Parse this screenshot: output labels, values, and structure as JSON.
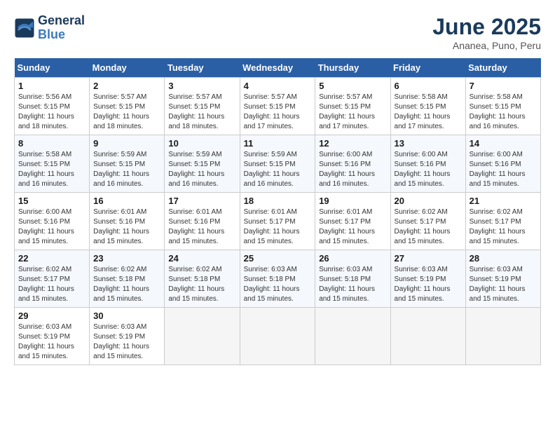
{
  "logo": {
    "line1": "General",
    "line2": "Blue"
  },
  "title": "June 2025",
  "subtitle": "Ananea, Puno, Peru",
  "days_of_week": [
    "Sunday",
    "Monday",
    "Tuesday",
    "Wednesday",
    "Thursday",
    "Friday",
    "Saturday"
  ],
  "weeks": [
    [
      {
        "day": "1",
        "sunrise": "Sunrise: 5:56 AM",
        "sunset": "Sunset: 5:15 PM",
        "daylight": "Daylight: 11 hours and 18 minutes."
      },
      {
        "day": "2",
        "sunrise": "Sunrise: 5:57 AM",
        "sunset": "Sunset: 5:15 PM",
        "daylight": "Daylight: 11 hours and 18 minutes."
      },
      {
        "day": "3",
        "sunrise": "Sunrise: 5:57 AM",
        "sunset": "Sunset: 5:15 PM",
        "daylight": "Daylight: 11 hours and 18 minutes."
      },
      {
        "day": "4",
        "sunrise": "Sunrise: 5:57 AM",
        "sunset": "Sunset: 5:15 PM",
        "daylight": "Daylight: 11 hours and 17 minutes."
      },
      {
        "day": "5",
        "sunrise": "Sunrise: 5:57 AM",
        "sunset": "Sunset: 5:15 PM",
        "daylight": "Daylight: 11 hours and 17 minutes."
      },
      {
        "day": "6",
        "sunrise": "Sunrise: 5:58 AM",
        "sunset": "Sunset: 5:15 PM",
        "daylight": "Daylight: 11 hours and 17 minutes."
      },
      {
        "day": "7",
        "sunrise": "Sunrise: 5:58 AM",
        "sunset": "Sunset: 5:15 PM",
        "daylight": "Daylight: 11 hours and 16 minutes."
      }
    ],
    [
      {
        "day": "8",
        "sunrise": "Sunrise: 5:58 AM",
        "sunset": "Sunset: 5:15 PM",
        "daylight": "Daylight: 11 hours and 16 minutes."
      },
      {
        "day": "9",
        "sunrise": "Sunrise: 5:59 AM",
        "sunset": "Sunset: 5:15 PM",
        "daylight": "Daylight: 11 hours and 16 minutes."
      },
      {
        "day": "10",
        "sunrise": "Sunrise: 5:59 AM",
        "sunset": "Sunset: 5:15 PM",
        "daylight": "Daylight: 11 hours and 16 minutes."
      },
      {
        "day": "11",
        "sunrise": "Sunrise: 5:59 AM",
        "sunset": "Sunset: 5:15 PM",
        "daylight": "Daylight: 11 hours and 16 minutes."
      },
      {
        "day": "12",
        "sunrise": "Sunrise: 6:00 AM",
        "sunset": "Sunset: 5:16 PM",
        "daylight": "Daylight: 11 hours and 16 minutes."
      },
      {
        "day": "13",
        "sunrise": "Sunrise: 6:00 AM",
        "sunset": "Sunset: 5:16 PM",
        "daylight": "Daylight: 11 hours and 15 minutes."
      },
      {
        "day": "14",
        "sunrise": "Sunrise: 6:00 AM",
        "sunset": "Sunset: 5:16 PM",
        "daylight": "Daylight: 11 hours and 15 minutes."
      }
    ],
    [
      {
        "day": "15",
        "sunrise": "Sunrise: 6:00 AM",
        "sunset": "Sunset: 5:16 PM",
        "daylight": "Daylight: 11 hours and 15 minutes."
      },
      {
        "day": "16",
        "sunrise": "Sunrise: 6:01 AM",
        "sunset": "Sunset: 5:16 PM",
        "daylight": "Daylight: 11 hours and 15 minutes."
      },
      {
        "day": "17",
        "sunrise": "Sunrise: 6:01 AM",
        "sunset": "Sunset: 5:16 PM",
        "daylight": "Daylight: 11 hours and 15 minutes."
      },
      {
        "day": "18",
        "sunrise": "Sunrise: 6:01 AM",
        "sunset": "Sunset: 5:17 PM",
        "daylight": "Daylight: 11 hours and 15 minutes."
      },
      {
        "day": "19",
        "sunrise": "Sunrise: 6:01 AM",
        "sunset": "Sunset: 5:17 PM",
        "daylight": "Daylight: 11 hours and 15 minutes."
      },
      {
        "day": "20",
        "sunrise": "Sunrise: 6:02 AM",
        "sunset": "Sunset: 5:17 PM",
        "daylight": "Daylight: 11 hours and 15 minutes."
      },
      {
        "day": "21",
        "sunrise": "Sunrise: 6:02 AM",
        "sunset": "Sunset: 5:17 PM",
        "daylight": "Daylight: 11 hours and 15 minutes."
      }
    ],
    [
      {
        "day": "22",
        "sunrise": "Sunrise: 6:02 AM",
        "sunset": "Sunset: 5:17 PM",
        "daylight": "Daylight: 11 hours and 15 minutes."
      },
      {
        "day": "23",
        "sunrise": "Sunrise: 6:02 AM",
        "sunset": "Sunset: 5:18 PM",
        "daylight": "Daylight: 11 hours and 15 minutes."
      },
      {
        "day": "24",
        "sunrise": "Sunrise: 6:02 AM",
        "sunset": "Sunset: 5:18 PM",
        "daylight": "Daylight: 11 hours and 15 minutes."
      },
      {
        "day": "25",
        "sunrise": "Sunrise: 6:03 AM",
        "sunset": "Sunset: 5:18 PM",
        "daylight": "Daylight: 11 hours and 15 minutes."
      },
      {
        "day": "26",
        "sunrise": "Sunrise: 6:03 AM",
        "sunset": "Sunset: 5:18 PM",
        "daylight": "Daylight: 11 hours and 15 minutes."
      },
      {
        "day": "27",
        "sunrise": "Sunrise: 6:03 AM",
        "sunset": "Sunset: 5:19 PM",
        "daylight": "Daylight: 11 hours and 15 minutes."
      },
      {
        "day": "28",
        "sunrise": "Sunrise: 6:03 AM",
        "sunset": "Sunset: 5:19 PM",
        "daylight": "Daylight: 11 hours and 15 minutes."
      }
    ],
    [
      {
        "day": "29",
        "sunrise": "Sunrise: 6:03 AM",
        "sunset": "Sunset: 5:19 PM",
        "daylight": "Daylight: 11 hours and 15 minutes."
      },
      {
        "day": "30",
        "sunrise": "Sunrise: 6:03 AM",
        "sunset": "Sunset: 5:19 PM",
        "daylight": "Daylight: 11 hours and 15 minutes."
      },
      null,
      null,
      null,
      null,
      null
    ]
  ]
}
